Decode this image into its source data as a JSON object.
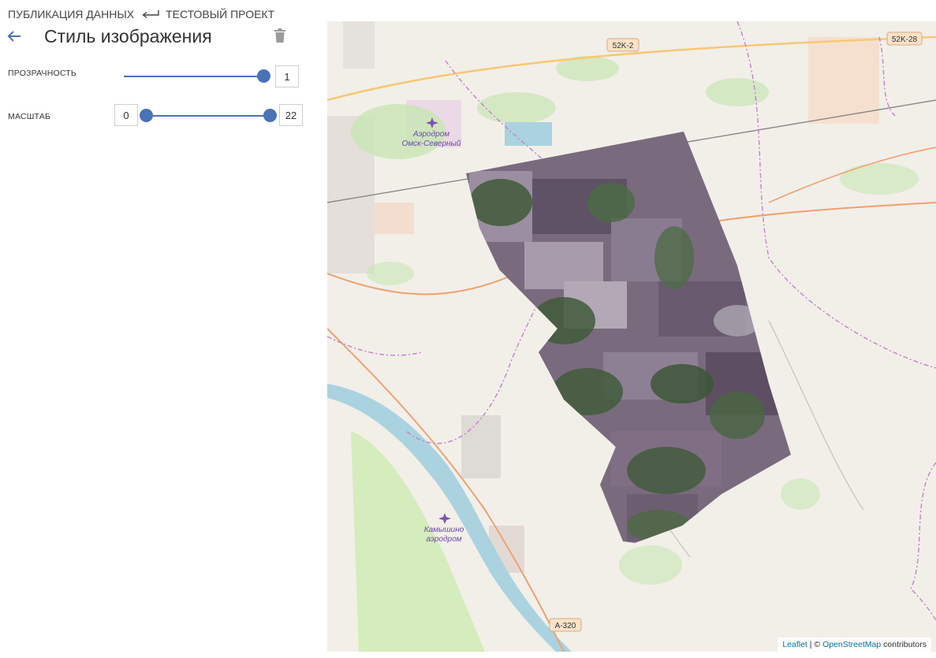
{
  "breadcrumb": {
    "parent": "ПУБЛИКАЦИЯ ДАННЫХ",
    "current": "ТЕСТОВЫЙ ПРОЕКТ"
  },
  "page_title": "Стиль изображения",
  "icons": {
    "back": "arrow-left-icon",
    "parent_link": "enter-return-icon",
    "delete": "trash-icon",
    "airport": "airplane-icon"
  },
  "controls": {
    "opacity": {
      "label": "ПРОЗРАЧНОСТЬ",
      "value": "1",
      "min": 0,
      "max": 1
    },
    "zoom": {
      "label": "МАСШТАБ",
      "min_value": "0",
      "max_value": "22",
      "min": 0,
      "max": 22
    }
  },
  "map": {
    "labels": {
      "road_52k2": "52K-2",
      "road_52k28": "52K-28",
      "road_a320": "A-320",
      "airport1_line1": "Аэродром",
      "airport1_line2": "Омск-Северный",
      "airport2_line1": "Камышино",
      "airport2_line2": "аэродром"
    },
    "attribution": {
      "leaflet": "Leaflet",
      "sep": " | © ",
      "osm": "OpenStreetMap",
      "suffix": " contributors"
    }
  },
  "colors": {
    "accent": "#4a72b8",
    "map_background": "#f2efe9",
    "water": "#aad3df",
    "forest": "#c8e6b4",
    "road": "#f0a070",
    "boundary": "#c77fc9",
    "raster_fields": "#7a6a7e",
    "raster_forest": "#3f5a3a"
  }
}
